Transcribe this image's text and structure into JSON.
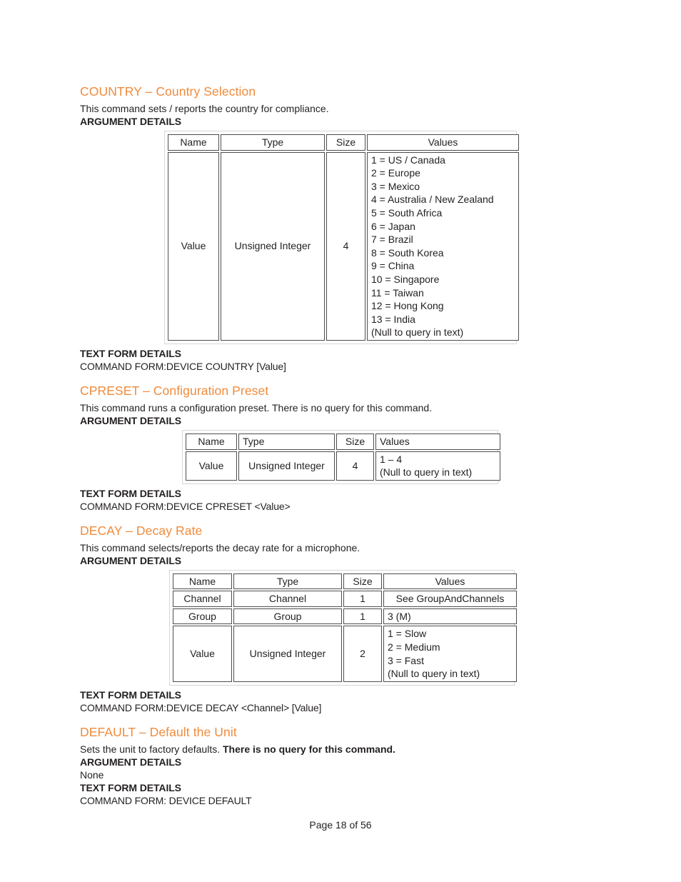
{
  "document": {
    "footer": "Page 18 of 56"
  },
  "labels": {
    "argument_details": "ARGUMENT DETAILS",
    "text_form_details": "TEXT FORM DETAILS"
  },
  "table_headers": {
    "name": "Name",
    "type": "Type",
    "size": "Size",
    "values": "Values"
  },
  "colors": {
    "heading_orange": "#f08b3c",
    "body_text": "#231f20",
    "cell_border": "#4d4d4d",
    "table_frame": "#d7d7d7"
  },
  "sections": [
    {
      "id": "country",
      "heading": "COUNTRY – Country Selection",
      "description": "This command sets / reports the country for compliance.",
      "rows": [
        {
          "name": "Value",
          "type": "Unsigned Integer",
          "size": "4",
          "values": "1 = US / Canada\n2 = Europe\n3 = Mexico\n4 = Australia / New Zealand\n5 = South Africa\n6 = Japan\n7 = Brazil\n8 = South Korea\n9 = China\n10 = Singapore\n11 = Taiwan\n12 = Hong Kong\n13 = India\n(Null to query in text)"
        }
      ],
      "command_form": "COMMAND FORM:DEVICE COUNTRY [Value]"
    },
    {
      "id": "cpreset",
      "heading": "CPRESET – Configuration Preset",
      "description": "This command runs a configuration preset. There is no query for this command.",
      "rows": [
        {
          "name": "Value",
          "type": "Unsigned Integer",
          "size": "4",
          "values": "1 – 4\n(Null to query in text)"
        }
      ],
      "command_form": "COMMAND FORM:DEVICE CPRESET <Value>"
    },
    {
      "id": "decay",
      "heading": "DECAY – Decay Rate",
      "description": "This command selects/reports the decay rate for a microphone.",
      "rows": [
        {
          "name": "Channel",
          "type": "Channel",
          "size": "1",
          "values": "See GroupAndChannels"
        },
        {
          "name": "Group",
          "type": "Group",
          "size": "1",
          "values": "3 (M)"
        },
        {
          "name": "Value",
          "type": "Unsigned Integer",
          "size": "2",
          "values": "1 = Slow\n2 = Medium\n3 = Fast\n(Null to query in text)"
        }
      ],
      "command_form": "COMMAND FORM:DEVICE DECAY <Channel> [Value]"
    },
    {
      "id": "default",
      "heading": "DEFAULT – Default the Unit",
      "description_plain": "Sets the unit to factory defaults. ",
      "description_bold": "There is no query for this command.",
      "arguments_none": "None",
      "command_form": "COMMAND FORM: DEVICE DEFAULT"
    }
  ]
}
